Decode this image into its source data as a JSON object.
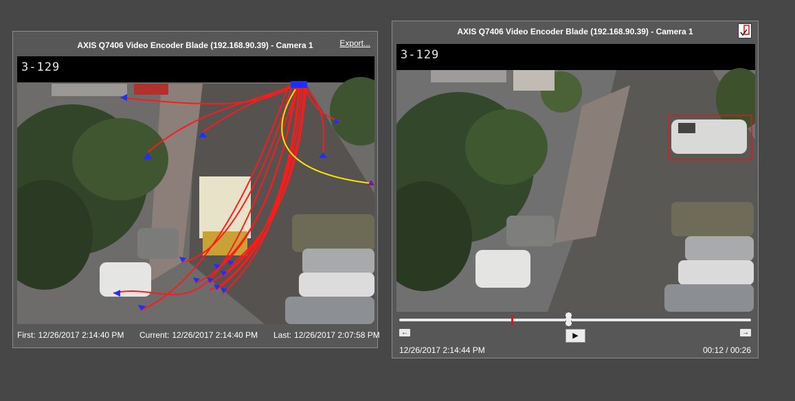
{
  "left_panel": {
    "title": "AXIS Q7406 Video Encoder Blade (192.168.90.39) - Camera 1",
    "export_label": "Export...",
    "video": {
      "camera_label": "3-129"
    },
    "first_label": "First:",
    "first_time": "12/26/2017 2:14:40 PM",
    "current_label": "Current:",
    "current_time": "12/26/2017 2:14:40 PM",
    "last_label": "Last:",
    "last_time": "12/26/2017 2:07:58 PM"
  },
  "right_panel": {
    "title": "AXIS Q7406 Video Encoder Blade (192.168.90.39) - Camera 1",
    "video": {
      "camera_label": "3-129"
    },
    "timestamp": "12/26/2017 2:14:44 PM",
    "duration": "00:12 / 00:26",
    "playhead_fraction": 0.48,
    "marker_fraction": 0.32,
    "icons": {
      "step_back": "step-back-icon",
      "play": "play-icon",
      "step_forward": "step-forward-icon",
      "action": "export-clip-icon"
    }
  },
  "colors": {
    "background": "#474747",
    "panel": "#575757",
    "track": "#ff0000",
    "highlight_track": "#ffe600",
    "track_point": "#1f2fff",
    "detection_box": "#d21f1f"
  }
}
